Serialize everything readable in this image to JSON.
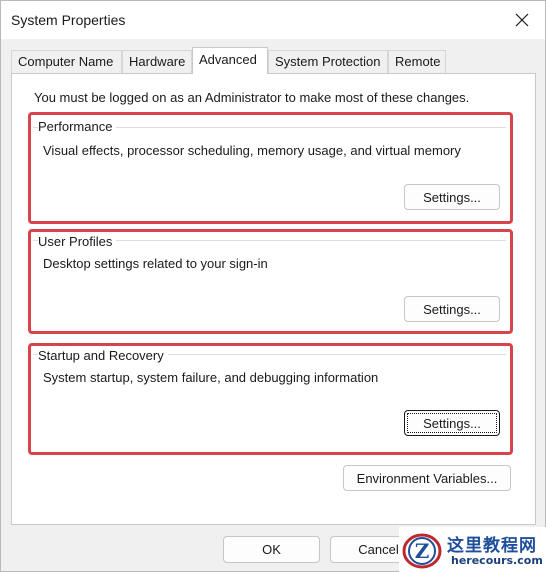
{
  "window": {
    "title": "System Properties",
    "close_icon": "close-icon"
  },
  "tabs": [
    {
      "label": "Computer Name",
      "active": false
    },
    {
      "label": "Hardware",
      "active": false
    },
    {
      "label": "Advanced",
      "active": true
    },
    {
      "label": "System Protection",
      "active": false
    },
    {
      "label": "Remote",
      "active": false
    }
  ],
  "panel": {
    "admin_note": "You must be logged on as an Administrator to make most of these changes."
  },
  "groups": [
    {
      "title": "Performance",
      "description": "Visual effects, processor scheduling, memory usage, and virtual memory",
      "button_label": "Settings..."
    },
    {
      "title": "User Profiles",
      "description": "Desktop settings related to your sign-in",
      "button_label": "Settings..."
    },
    {
      "title": "Startup and Recovery",
      "description": "System startup, system failure, and debugging information",
      "button_label": "Settings..."
    }
  ],
  "environment_button": "Environment Variables...",
  "footer": {
    "ok_label": "OK",
    "cancel_label": "Cancel"
  },
  "watermark": {
    "title": "这里教程网",
    "subtitle": "herecours.com"
  },
  "colors": {
    "highlight_border": "#d9434b",
    "panel_bg": "#ffffff",
    "window_bg": "#f0f0f0",
    "watermark_blue": "#1f4f9a"
  }
}
